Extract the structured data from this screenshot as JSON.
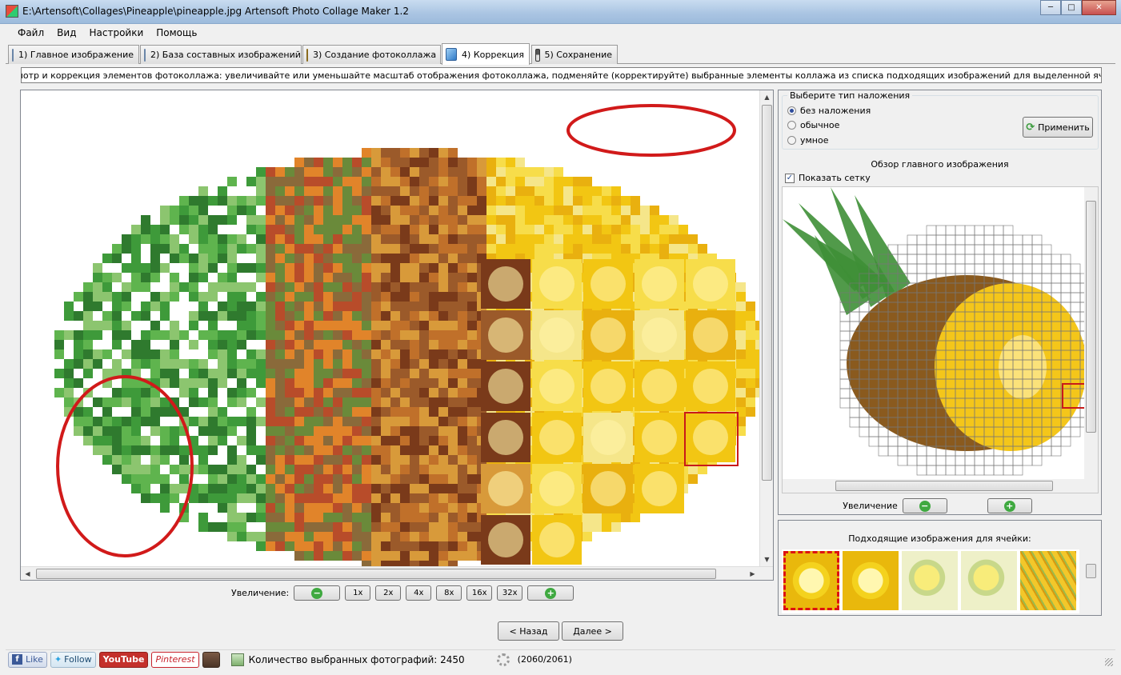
{
  "window": {
    "title": "E:\\Artensoft\\Collages\\Pineapple\\pineapple.jpg Artensoft Photo Collage Maker 1.2",
    "controls": [
      "─",
      "□",
      "✕"
    ]
  },
  "menu": [
    "Файл",
    "Вид",
    "Настройки",
    "Помощь"
  ],
  "tabs": [
    {
      "label": "1) Главное изображение",
      "icon": "image-icon",
      "active": false
    },
    {
      "label": "2) База составных изображений",
      "icon": "database-icon",
      "active": false
    },
    {
      "label": "3) Создание фотоколлажа",
      "icon": "magic-wand-icon",
      "active": false
    },
    {
      "label": "4) Коррекция",
      "icon": "cube-icon",
      "active": true
    },
    {
      "label": "5) Сохранение",
      "icon": "floppy-icon",
      "active": false
    }
  ],
  "info_text": "Просмотр и коррекция элементов фотоколлажа: увеличивайте или уменьшайте масштаб отображения фотоколлажа, подменяйте (корректируйте) выбранные элементы коллажа из списка подходящих изображений для выделенной ячейки.",
  "zoom": {
    "label": "Увеличение:",
    "levels": [
      "1x",
      "2x",
      "4x",
      "8x",
      "16x",
      "32x"
    ]
  },
  "nav": {
    "back": "< Назад",
    "next": "Далее >"
  },
  "overlay": {
    "group_title": "Выберите тип наложения",
    "options": [
      {
        "label": "без наложения",
        "selected": true
      },
      {
        "label": "обычное",
        "selected": false
      },
      {
        "label": "умное",
        "selected": false
      }
    ],
    "apply": "Применить"
  },
  "preview": {
    "title": "Обзор главного изображения",
    "show_grid_label": "Показать сетку",
    "show_grid": true,
    "zoom_label": "Увеличение"
  },
  "matches": {
    "title": "Подходящие изображения для ячейки:",
    "items": [
      "lemon-slice",
      "lemon-slice",
      "lemon-on-plate",
      "lemon-on-plate",
      "corn"
    ]
  },
  "statusbar": {
    "like": "Like",
    "follow": "Follow",
    "youtube": "YouTube",
    "pinterest": "Pinterest",
    "count_text": "Количество выбранных фотографий: 2450",
    "progress": "(2060/2061)"
  },
  "colors": {
    "accent": "#d11a1a",
    "leaf_green": "#3e9a3a",
    "fruit_yellow": "#f2c613",
    "nut_brown": "#9b5a2a",
    "fruit_orange": "#e1842a"
  }
}
